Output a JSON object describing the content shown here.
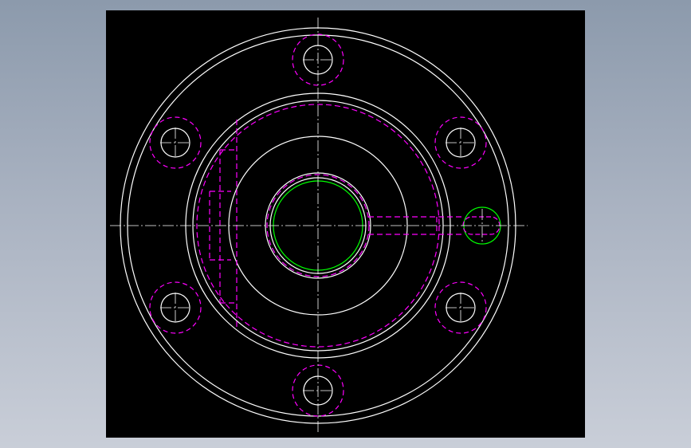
{
  "viewer": {
    "background": "black",
    "canvas_color": "#000000"
  },
  "colors": {
    "outline": "#ffffff",
    "hidden_lines": "#ff00ff",
    "highlight": "#00ff00"
  },
  "drawing": {
    "view": "top-view",
    "part": "flange",
    "bolt_holes_count": 6,
    "line_types": [
      "continuous",
      "hidden-dashed",
      "center-dash-dot"
    ]
  }
}
